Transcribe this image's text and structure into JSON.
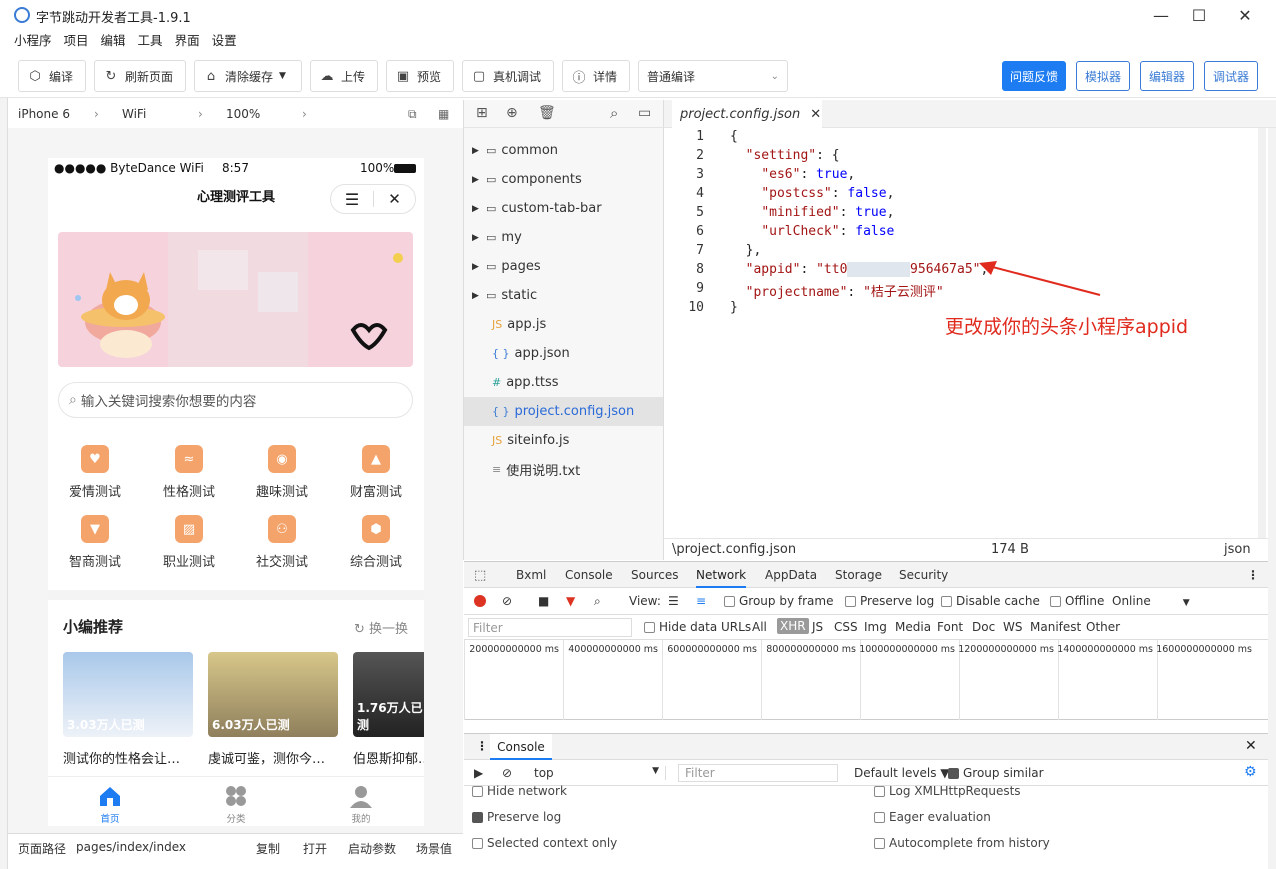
{
  "window": {
    "title": "字节跳动开发者工具-1.9.1",
    "controls": {
      "minimize": "—",
      "maximize": "☐",
      "close": "✕"
    }
  },
  "menu": [
    "小程序",
    "项目",
    "编辑",
    "工具",
    "界面",
    "设置"
  ],
  "toolbar": {
    "compile": "编译",
    "refresh": "刷新页面",
    "clear_cache": "清除缓存",
    "upload": "上传",
    "preview": "预览",
    "remote_debug": "真机调试",
    "details": "详情",
    "compile_mode": "普通编译",
    "feedback": "问题反馈",
    "simulator": "模拟器",
    "editor": "编辑器",
    "debugger": "调试器"
  },
  "simulator_bar": {
    "device": "iPhone 6",
    "network": "WiFi",
    "zoom": "100%"
  },
  "phone": {
    "status": {
      "carrier": "●●●●● ByteDance WiFi",
      "time": "8:57",
      "battery": "100%"
    },
    "nav_title": "心理测评工具",
    "search_placeholder": "输入关键词搜索你想要的内容",
    "categories": [
      "爱情测试",
      "性格测试",
      "趣味测试",
      "财富测试",
      "智商测试",
      "职业测试",
      "社交测试",
      "综合测试"
    ],
    "recommend": {
      "title": "小编推荐",
      "refresh": "换一换",
      "cards": [
        {
          "count": "3.03万人已测",
          "title": "测试你的性格会让…"
        },
        {
          "count": "6.03万人已测",
          "title": "虔诚可鉴，测你今…"
        },
        {
          "count": "1.76万人已测",
          "title": "伯恩斯抑郁…"
        }
      ]
    },
    "tabs": [
      "首页",
      "分类",
      "我的"
    ]
  },
  "path_bar": {
    "label": "页面路径",
    "path": "pages/index/index",
    "copy": "复制",
    "open": "打开",
    "params": "启动参数",
    "scene": "场景值"
  },
  "file_tree": [
    {
      "name": "common",
      "type": "folder"
    },
    {
      "name": "components",
      "type": "folder"
    },
    {
      "name": "custom-tab-bar",
      "type": "folder"
    },
    {
      "name": "my",
      "type": "folder"
    },
    {
      "name": "pages",
      "type": "folder"
    },
    {
      "name": "static",
      "type": "folder"
    },
    {
      "name": "app.js",
      "type": "js"
    },
    {
      "name": "app.json",
      "type": "json"
    },
    {
      "name": "app.ttss",
      "type": "ttss"
    },
    {
      "name": "project.config.json",
      "type": "json",
      "selected": true
    },
    {
      "name": "siteinfo.js",
      "type": "js"
    },
    {
      "name": "使用说明.txt",
      "type": "txt"
    }
  ],
  "editor": {
    "tab": "project.config.json",
    "lines": [
      "1",
      "2",
      "3",
      "4",
      "5",
      "6",
      "7",
      "8",
      "9",
      "10"
    ],
    "annotation": "更改成你的头条小程序appid",
    "status": {
      "path": "\\project.config.json",
      "size": "174 B",
      "lang": "json"
    }
  },
  "devtools": {
    "tabs": [
      "Bxml",
      "Console",
      "Sources",
      "Network",
      "AppData",
      "Storage",
      "Security"
    ],
    "active_tab": "Network",
    "net_toolbar": {
      "view": "View:",
      "group_by_frame": "Group by frame",
      "preserve_log": "Preserve log",
      "disable_cache": "Disable cache",
      "offline": "Offline",
      "online": "Online"
    },
    "filter": {
      "placeholder": "Filter",
      "hide_data_urls": "Hide data URLs",
      "types": [
        "All",
        "XHR",
        "JS",
        "CSS",
        "Img",
        "Media",
        "Font",
        "Doc",
        "WS",
        "Manifest",
        "Other"
      ]
    },
    "timeline_ticks": [
      "200000000000 ms",
      "400000000000 ms",
      "600000000000 ms",
      "800000000000 ms",
      "1000000000000 ms",
      "1200000000000 ms",
      "1400000000000 ms",
      "1600000000000 ms"
    ],
    "console": {
      "title": "Console",
      "context": "top",
      "filter": "Filter",
      "levels": "Default levels ▼",
      "group_similar": "Group similar",
      "options": [
        {
          "label": "Hide network",
          "checked": false
        },
        {
          "label": "Log XMLHttpRequests",
          "checked": false
        },
        {
          "label": "Preserve log",
          "checked": true
        },
        {
          "label": "Eager evaluation",
          "checked": false
        },
        {
          "label": "Selected context only",
          "checked": false
        },
        {
          "label": "Autocomplete from history",
          "checked": false
        }
      ]
    }
  },
  "colors": {
    "accent": "#1d7cf2",
    "annotation": "#e02a1e",
    "category_icon": "#f4a36a"
  }
}
